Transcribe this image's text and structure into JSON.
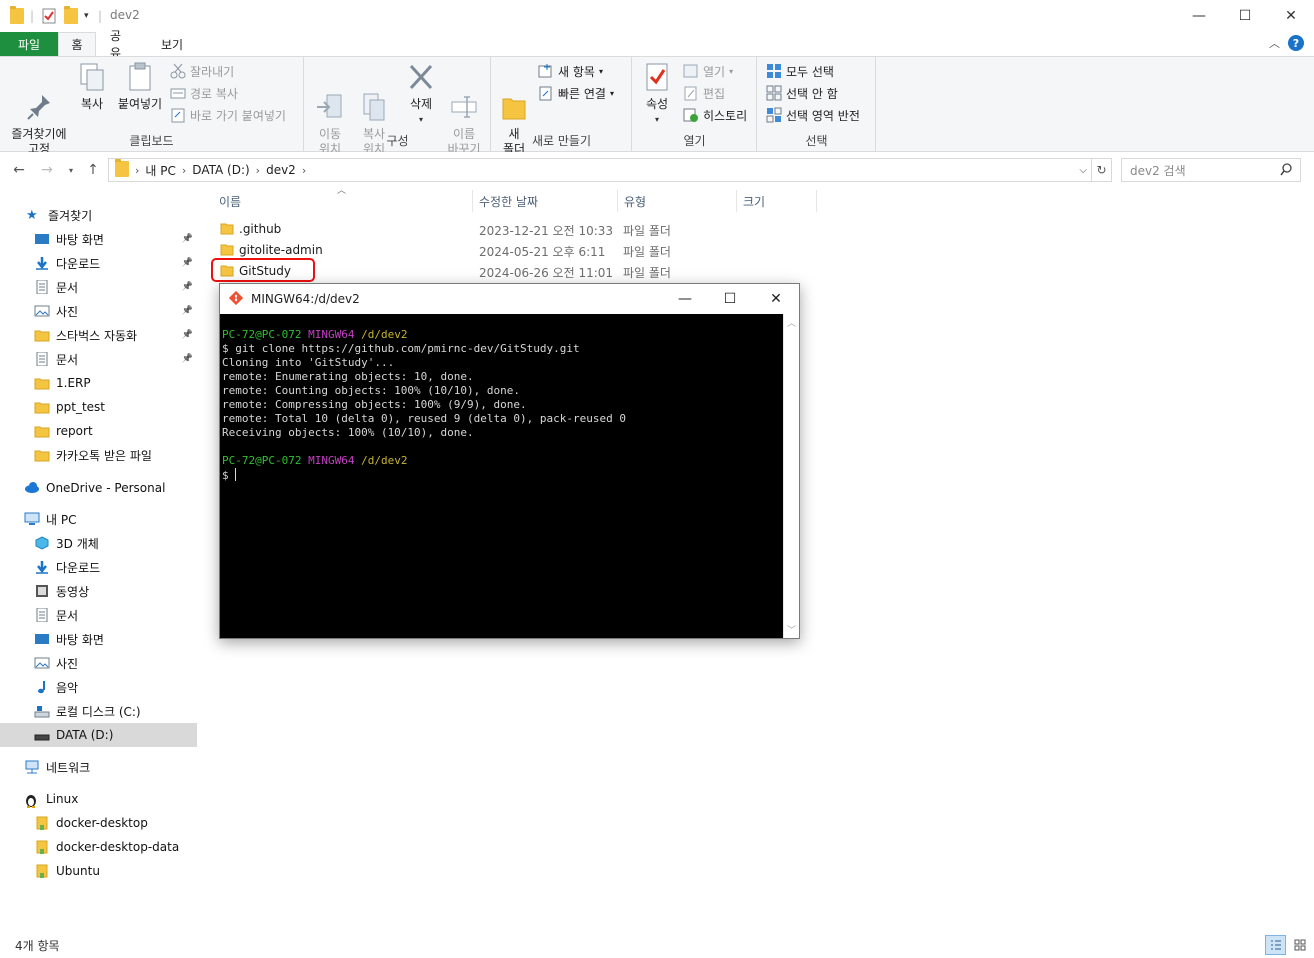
{
  "window": {
    "title": "dev2",
    "controls": {
      "minimize": "—",
      "maximize": "☐",
      "close": "✕"
    }
  },
  "ribbon": {
    "tabs": [
      "파일",
      "홈",
      "공유",
      "보기"
    ],
    "groups": {
      "clipboard": {
        "label": "클립보드",
        "pin": "즐겨찾기에\n고정",
        "copy": "복사",
        "paste": "붙여넣기",
        "cut": "잘라내기",
        "copy_path": "경로 복사",
        "paste_shortcut": "바로 가기 붙여넣기"
      },
      "organize": {
        "label": "구성",
        "move_to": "이동\n위치",
        "copy_to": "복사\n위치",
        "delete": "삭제",
        "rename": "이름\n바꾸기"
      },
      "new": {
        "label": "새로 만들기",
        "new_folder": "새\n폴더",
        "new_item": "새 항목",
        "easy_access": "빠른 연결"
      },
      "open": {
        "label": "열기",
        "properties": "속성",
        "open": "열기",
        "edit": "편집",
        "history": "히스토리"
      },
      "select": {
        "label": "선택",
        "select_all": "모두 선택",
        "select_none": "선택 안 함",
        "invert": "선택 영역 반전"
      }
    }
  },
  "address": {
    "crumbs": [
      "내 PC",
      "DATA (D:)",
      "dev2"
    ],
    "search_placeholder": "dev2 검색"
  },
  "nav": {
    "quick_access": "즐겨찾기",
    "quick_items": [
      {
        "label": "바탕 화면",
        "pinned": true
      },
      {
        "label": "다운로드",
        "pinned": true
      },
      {
        "label": "문서",
        "pinned": true
      },
      {
        "label": "사진",
        "pinned": true
      },
      {
        "label": "스타벅스 자동화",
        "pinned": true
      },
      {
        "label": "문서",
        "pinned": true
      },
      {
        "label": "1.ERP",
        "pinned": false
      },
      {
        "label": "ppt_test",
        "pinned": false
      },
      {
        "label": "report",
        "pinned": false
      },
      {
        "label": "카카오톡 받은 파일",
        "pinned": false
      }
    ],
    "onedrive": "OneDrive - Personal",
    "this_pc": "내 PC",
    "pc_items": [
      "3D 개체",
      "다운로드",
      "동영상",
      "문서",
      "바탕 화면",
      "사진",
      "음악",
      "로컬 디스크 (C:)",
      "DATA (D:)"
    ],
    "network": "네트워크",
    "linux": "Linux",
    "linux_items": [
      "docker-desktop",
      "docker-desktop-data",
      "Ubuntu"
    ]
  },
  "columns": {
    "name": "이름",
    "date": "수정한 날짜",
    "type": "유형",
    "size": "크기"
  },
  "files": [
    {
      "name": ".github",
      "date": "2023-12-21 오전 10:33",
      "type": "파일 폴더"
    },
    {
      "name": "gitolite-admin",
      "date": "2024-05-21 오후 6:11",
      "type": "파일 폴더"
    },
    {
      "name": "GitStudy",
      "date": "2024-06-26 오전 11:01",
      "type": "파일 폴더"
    }
  ],
  "status": {
    "count": "4개 항목"
  },
  "terminal": {
    "title": "MINGW64:/d/dev2",
    "prompt_user": "PC-72@PC-072",
    "prompt_env": "MINGW64",
    "prompt_path": "/d/dev2",
    "command": "$ git clone https://github.com/pmirnc-dev/GitStudy.git",
    "output": [
      "Cloning into 'GitStudy'...",
      "remote: Enumerating objects: 10, done.",
      "remote: Counting objects: 100% (10/10), done.",
      "remote: Compressing objects: 100% (9/9), done.",
      "remote: Total 10 (delta 0), reused 9 (delta 0), pack-reused 0",
      "Receiving objects: 100% (10/10), done."
    ],
    "prompt2_user": "PC-72@PC-072",
    "prompt2_env": "MINGW64",
    "prompt2_path": "/d/dev2",
    "dollar": "$ "
  }
}
